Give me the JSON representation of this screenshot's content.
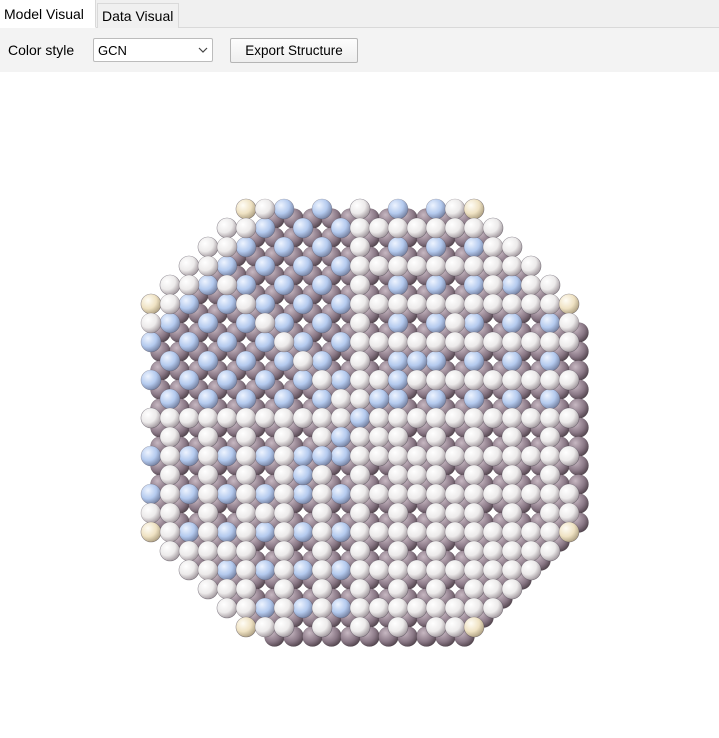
{
  "tabs": [
    {
      "label": "Model Visual",
      "active": true
    },
    {
      "label": "Data Visual",
      "active": false
    }
  ],
  "toolbar": {
    "color_style_label": "Color style",
    "color_style_value": "GCN",
    "export_label": "Export Structure"
  },
  "viewport": {
    "content": "nanoparticle-3d-model",
    "colors": {
      "surface_atom": "#f4f4f4",
      "core_atom": "#b9cff0",
      "vertex_atom": "#f2e6c8",
      "shadow": "#6c5a66"
    }
  }
}
